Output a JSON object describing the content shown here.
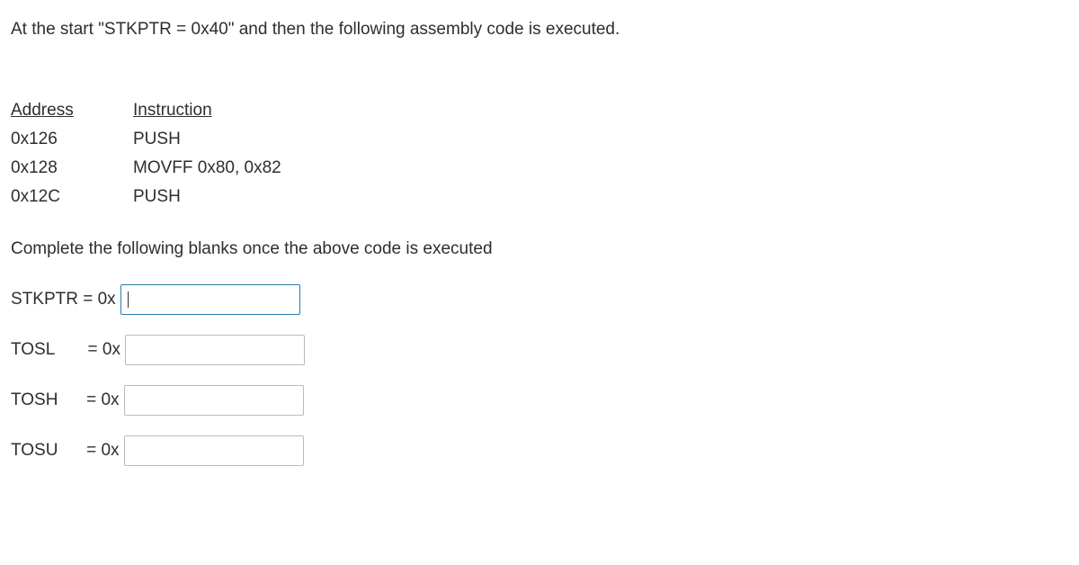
{
  "intro": "At the start \"STKPTR = 0x40\" and then the following assembly code is executed.",
  "headers": {
    "address": "Address ",
    "instruction": " Instruction"
  },
  "code": [
    {
      "address": "0x126",
      "instruction": "PUSH"
    },
    {
      "address": "0x128",
      "instruction": "MOVFF   0x80, 0x82"
    },
    {
      "address": "0x12C",
      "instruction": "PUSH"
    }
  ],
  "prompt": "Complete the following blanks once the above code is executed",
  "answers": [
    {
      "label": "STKPTR = 0x ",
      "value": "",
      "focused": true
    },
    {
      "label": "TOSL       = 0x ",
      "value": "",
      "focused": false
    },
    {
      "label": "TOSH      = 0x ",
      "value": "",
      "focused": false
    },
    {
      "label": "TOSU      = 0x ",
      "value": "",
      "focused": false
    }
  ]
}
